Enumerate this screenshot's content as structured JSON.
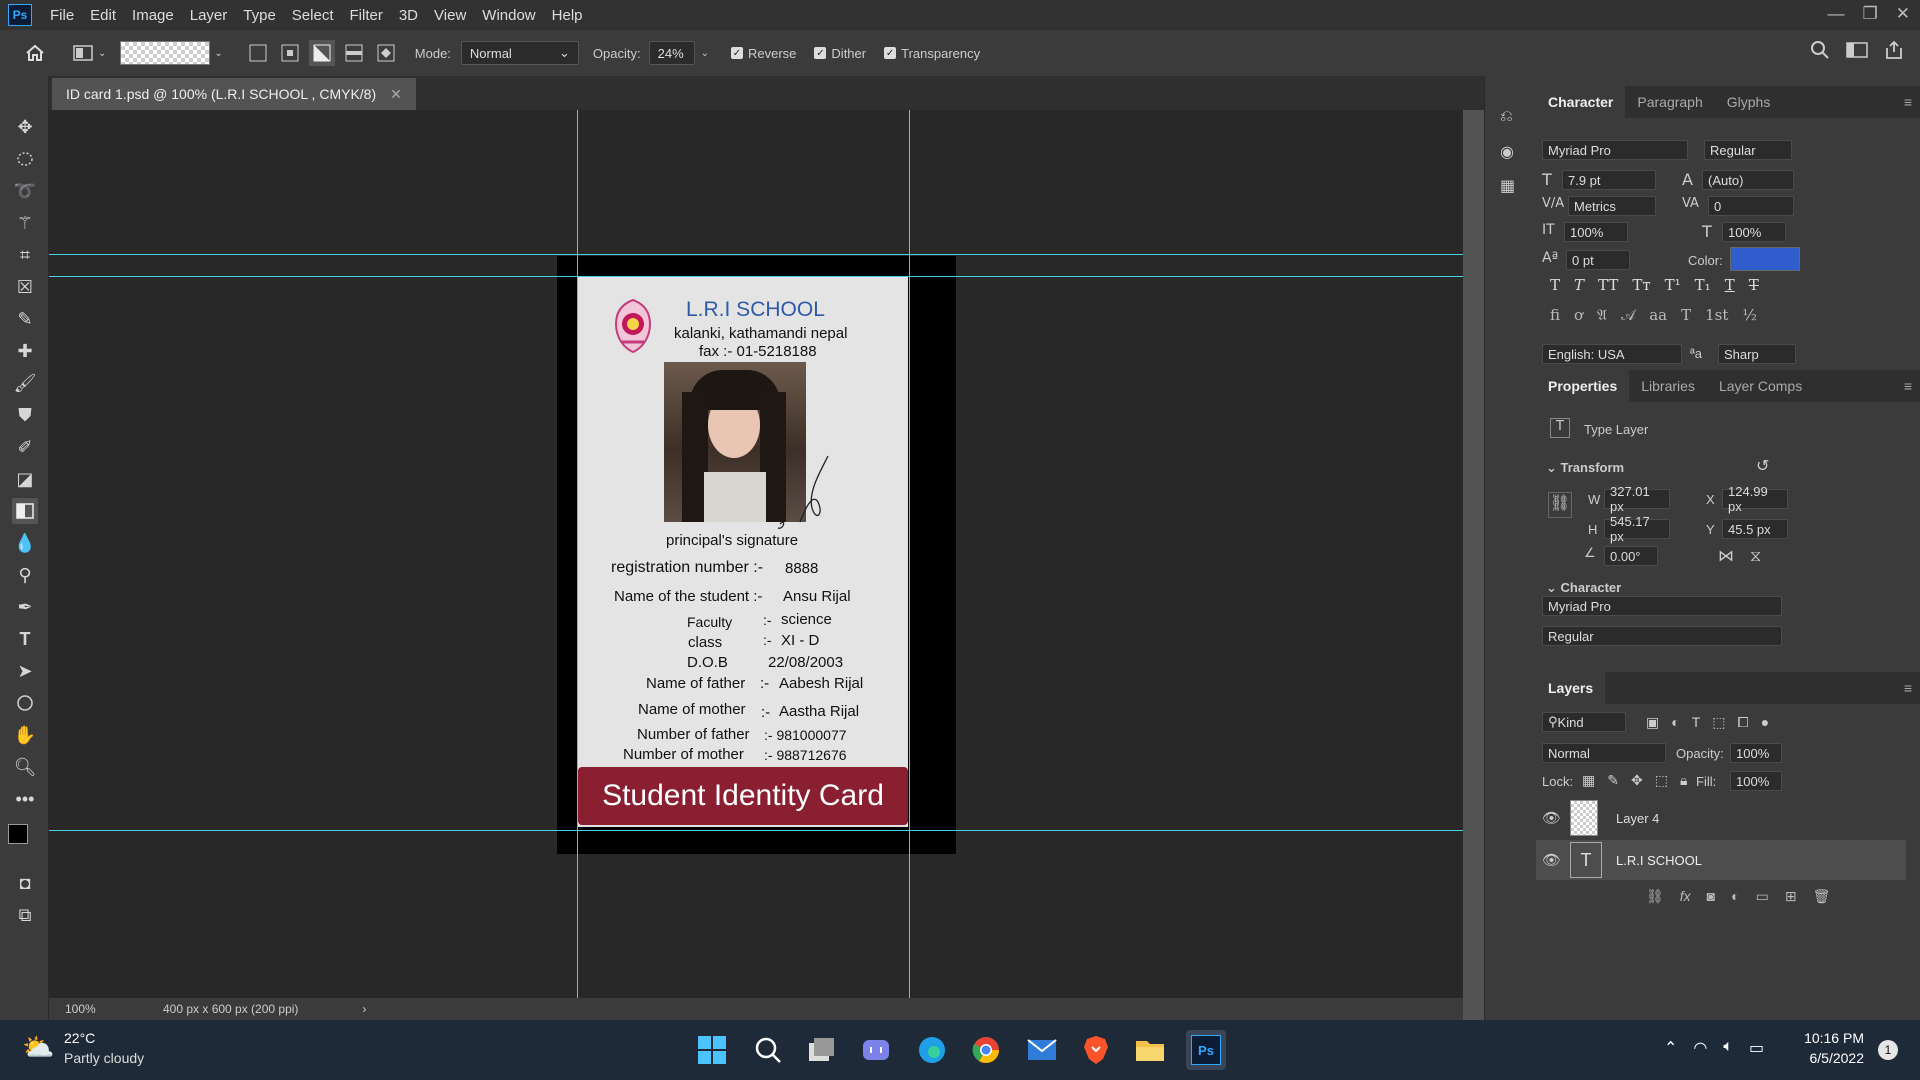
{
  "app": {
    "logo": "Ps"
  },
  "menu": [
    "File",
    "Edit",
    "Image",
    "Layer",
    "Type",
    "Select",
    "Filter",
    "3D",
    "View",
    "Window",
    "Help"
  ],
  "window_controls": {
    "minimize": "—",
    "restore": "❐",
    "close": "✕"
  },
  "options": {
    "mode_label": "Mode:",
    "mode_value": "Normal",
    "opacity_label": "Opacity:",
    "opacity_value": "24%",
    "reverse_label": "Reverse",
    "dither_label": "Dither",
    "transparency_label": "Transparency"
  },
  "document": {
    "tab_title": "ID card 1.psd @ 100% (L.R.I SCHOOL , CMYK/8)",
    "zoom": "100%",
    "doc_info": "400 px x 600 px (200 ppi)"
  },
  "card": {
    "school": "L.R.I SCHOOL",
    "address": "kalanki, kathamandi nepal",
    "fax": "fax :- 01-5218188",
    "signature_label": "principal's signature",
    "reg_label": "registration number :-",
    "reg_value": "8888",
    "student_label": "Name of the student :-",
    "student_value": "Ansu Rijal",
    "faculty_label": "Faculty",
    "faculty_sep": ":-",
    "faculty_value": "science",
    "class_label": "class",
    "class_sep": ":-",
    "class_value": "XI - D",
    "dob_label": "D.O.B",
    "dob_value": "22/08/2003",
    "father_label": "Name of father",
    "father_sep": ":-",
    "father_value": "Aabesh  Rijal",
    "mother_label": "Name of mother",
    "mother_sep": ":-",
    "mother_value": "Aastha  Rijal",
    "father_num_label": "Number of father",
    "father_num_value": ":- 981000077",
    "mother_num_label": "Number of  mother",
    "mother_num_value": ":- 988712676",
    "banner": "Student Identity Card"
  },
  "character_panel": {
    "tabs": [
      "Character",
      "Paragraph",
      "Glyphs"
    ],
    "font_family": "Myriad Pro",
    "font_style": "Regular",
    "font_size": "7.9 pt",
    "leading": "(Auto)",
    "kerning": "Metrics",
    "tracking": "0",
    "vscale": "100%",
    "hscale": "100%",
    "baseline": "0 pt",
    "color_label": "Color:",
    "language": "English: USA",
    "aa_label": "ªa",
    "antialias": "Sharp",
    "color": "#2f5dcd"
  },
  "properties_panel": {
    "tabs": [
      "Properties",
      "Libraries",
      "Layer Comps"
    ],
    "layer_type": "Type Layer",
    "transform_title": "Transform",
    "w_label": "W",
    "w_value": "327.01 px",
    "x_label": "X",
    "x_value": "124.99 px",
    "h_label": "H",
    "h_value": "545.17 px",
    "y_label": "Y",
    "y_value": "45.5 px",
    "angle_value": "0.00°",
    "character_title": "Character",
    "font_family": "Myriad Pro",
    "font_style": "Regular"
  },
  "layers_panel": {
    "tab": "Layers",
    "filter_kind": "Kind",
    "blend_mode": "Normal",
    "opacity_label": "Opacity:",
    "opacity_value": "100%",
    "lock_label": "Lock:",
    "fill_label": "Fill:",
    "fill_value": "100%",
    "layers": [
      {
        "name": "Layer 4",
        "selected": false
      },
      {
        "name": "L.R.I SCHOOL",
        "selected": true
      }
    ]
  },
  "taskbar": {
    "temperature": "22°C",
    "weather": "Partly cloudy",
    "time": "10:16 PM",
    "date": "6/5/2022",
    "notification_count": "1"
  },
  "colors": {
    "accent": "#31a8ff",
    "guide": "#46d0e3",
    "banner": "#8b1f32",
    "school_blue": "#2f5aa8"
  }
}
